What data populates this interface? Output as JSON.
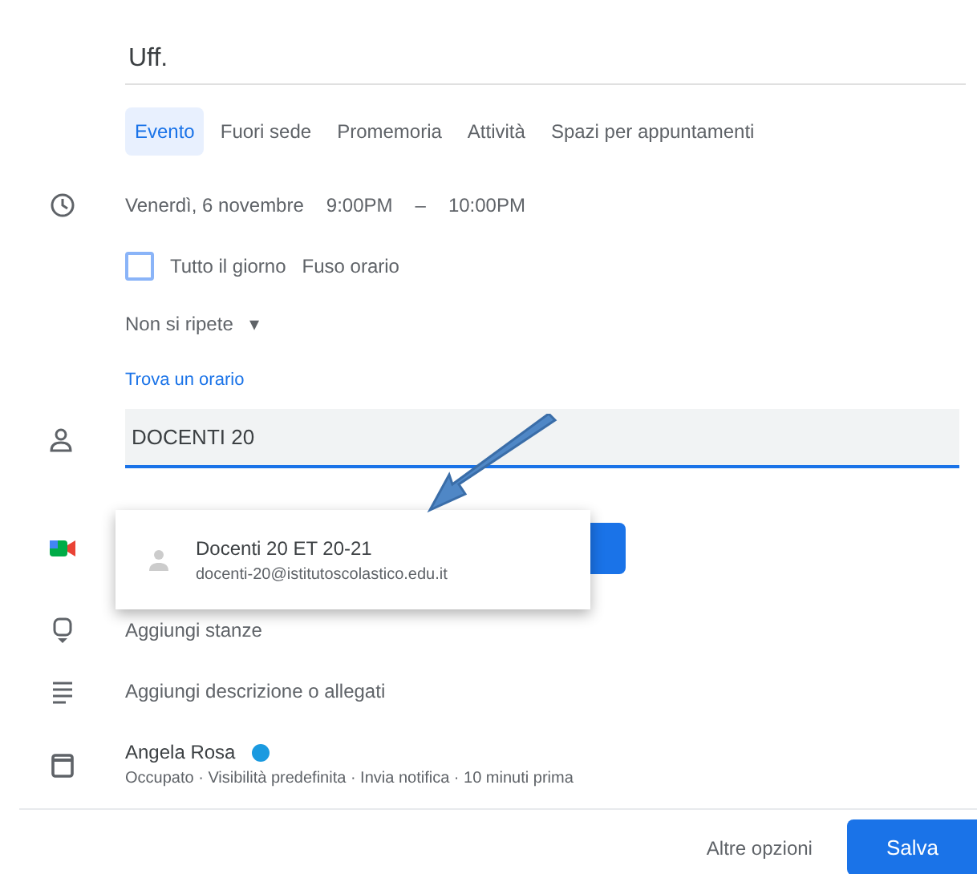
{
  "title": {
    "value": "Uff."
  },
  "tabs": [
    {
      "label": "Evento",
      "selected": true
    },
    {
      "label": "Fuori sede",
      "selected": false
    },
    {
      "label": "Promemoria",
      "selected": false
    },
    {
      "label": "Attività",
      "selected": false
    },
    {
      "label": "Spazi per appuntamenti",
      "selected": false
    }
  ],
  "time": {
    "date": "Venerdì, 6 novembre",
    "start": "9:00PM",
    "separator": "–",
    "end": "10:00PM"
  },
  "all_day": {
    "label": "Tutto il giorno",
    "checked": false
  },
  "timezone": "Fuso orario",
  "repeat": {
    "label": "Non si ripete",
    "caret": "▾"
  },
  "find_time": "Trova un orario",
  "guests": {
    "value": "DOCENTI 20"
  },
  "suggestion": {
    "name": "Docenti 20 ET 20-21",
    "email": "docenti-20@istitutoscolastico.edu.it"
  },
  "rooms": "Aggiungi stanze",
  "description": "Aggiungi descrizione o allegati",
  "calendar": {
    "owner": "Angela Rosa",
    "color": "#1a9ae0",
    "details": "Occupato · Visibilità predefinita · Invia notifica · 10 minuti prima"
  },
  "buttons": {
    "more": "Altre opzioni",
    "save": "Salva"
  }
}
